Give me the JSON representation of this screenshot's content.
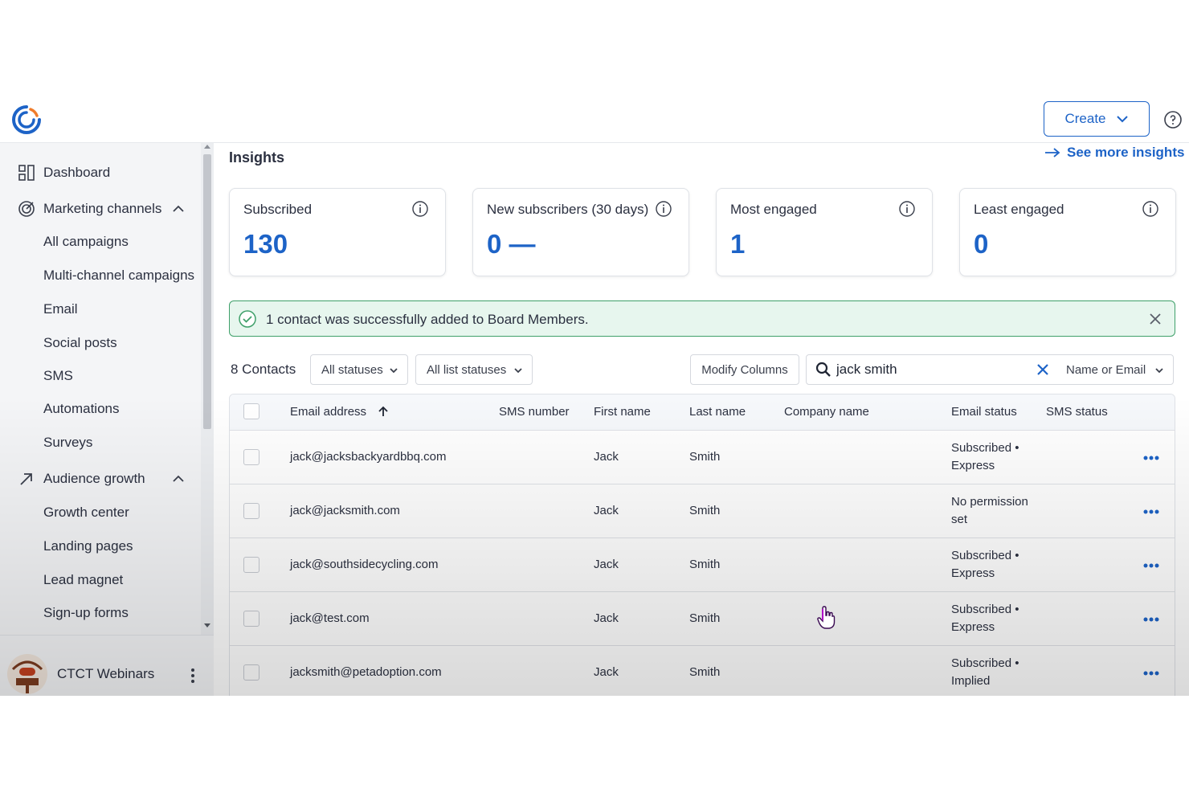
{
  "header": {
    "create_label": "Create"
  },
  "sidebar": {
    "items": [
      {
        "label": "Dashboard",
        "icon": "dashboard-icon"
      },
      {
        "label": "Marketing channels",
        "icon": "target-icon",
        "expanded": true
      },
      {
        "label": "All campaigns"
      },
      {
        "label": "Multi-channel campaigns"
      },
      {
        "label": "Email"
      },
      {
        "label": "Social posts"
      },
      {
        "label": "SMS"
      },
      {
        "label": "Automations"
      },
      {
        "label": "Surveys"
      },
      {
        "label": "Audience growth",
        "icon": "trend-arrow-icon",
        "expanded": true
      },
      {
        "label": "Growth center"
      },
      {
        "label": "Landing pages"
      },
      {
        "label": "Lead magnet"
      },
      {
        "label": "Sign-up forms"
      }
    ],
    "account_name": "CTCT Webinars"
  },
  "insights": {
    "title": "Insights",
    "see_more": "See more insights",
    "cards": [
      {
        "title": "Subscribed",
        "value": "130"
      },
      {
        "title": "New subscribers (30 days)",
        "value": "0 —"
      },
      {
        "title": "Most engaged",
        "value": "1"
      },
      {
        "title": "Least engaged",
        "value": "0"
      }
    ]
  },
  "alert": {
    "message": "1 contact was successfully added to Board Members."
  },
  "toolbar": {
    "contacts_count": "8 Contacts",
    "status_filter": "All statuses",
    "list_status_filter": "All list statuses",
    "modify_columns": "Modify Columns",
    "search_value": "jack smith",
    "search_scope": "Name or Email"
  },
  "table": {
    "columns": [
      "Email address",
      "SMS number",
      "First name",
      "Last name",
      "Company name",
      "Email status",
      "SMS status"
    ],
    "rows": [
      {
        "email": "jack@jacksbackyardbbq.com",
        "sms": "",
        "first": "Jack",
        "last": "Smith",
        "company": "",
        "email_status": "Subscribed • Express",
        "sms_status": ""
      },
      {
        "email": "jack@jacksmith.com",
        "sms": "",
        "first": "Jack",
        "last": "Smith",
        "company": "",
        "email_status": "No permission set",
        "sms_status": ""
      },
      {
        "email": "jack@southsidecycling.com",
        "sms": "",
        "first": "Jack",
        "last": "Smith",
        "company": "",
        "email_status": "Subscribed • Express",
        "sms_status": ""
      },
      {
        "email": "jack@test.com",
        "sms": "",
        "first": "Jack",
        "last": "Smith",
        "company": "",
        "email_status": "Subscribed • Express",
        "sms_status": ""
      },
      {
        "email": "jacksmith@petadoption.com",
        "sms": "",
        "first": "Jack",
        "last": "Smith",
        "company": "",
        "email_status": "Subscribed • Implied",
        "sms_status": ""
      }
    ]
  },
  "colors": {
    "accent": "#1d63c7",
    "success_border": "#3fa06a",
    "success_bg": "#e7f6ee"
  }
}
